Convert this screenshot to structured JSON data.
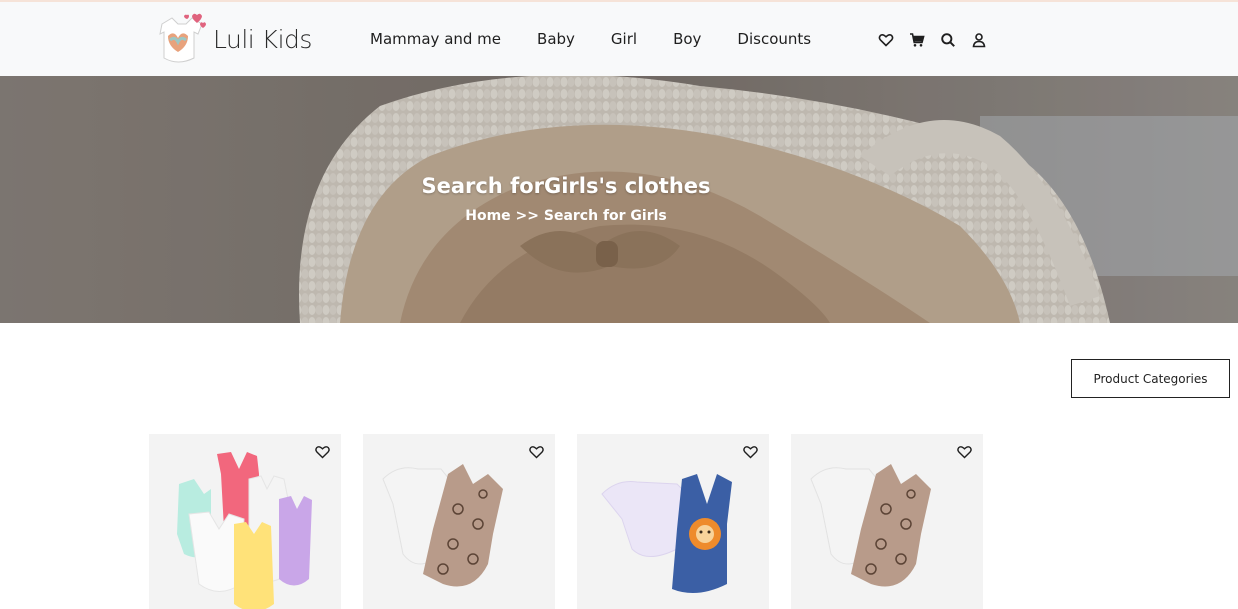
{
  "brand": {
    "name": "Luli Kids"
  },
  "nav": {
    "items": [
      {
        "label": "Mammay and me"
      },
      {
        "label": "Baby"
      },
      {
        "label": "Girl"
      },
      {
        "label": "Boy"
      },
      {
        "label": "Discounts"
      }
    ]
  },
  "header_icons": [
    "heart-icon",
    "cart-icon",
    "search-icon",
    "user-icon"
  ],
  "hero": {
    "title": "Search forGirls's clothes",
    "breadcrumb": {
      "home": "Home",
      "separator": ">>",
      "current": "Search for Girls"
    }
  },
  "categories_button": {
    "label": "Product Categories"
  },
  "products": [
    {
      "image": "assorted girls bodysuits",
      "icon": "heart-icon"
    },
    {
      "image": "white tee and floral romper",
      "icon": "heart-icon"
    },
    {
      "image": "lilac tee and denim lion overall",
      "icon": "heart-icon"
    },
    {
      "image": "white tee and floral romper",
      "icon": "heart-icon"
    }
  ],
  "colors": {
    "header_bg": "#f8f9fa",
    "text_dark": "#1f1f1f",
    "card_bg": "#f3f3f3"
  }
}
